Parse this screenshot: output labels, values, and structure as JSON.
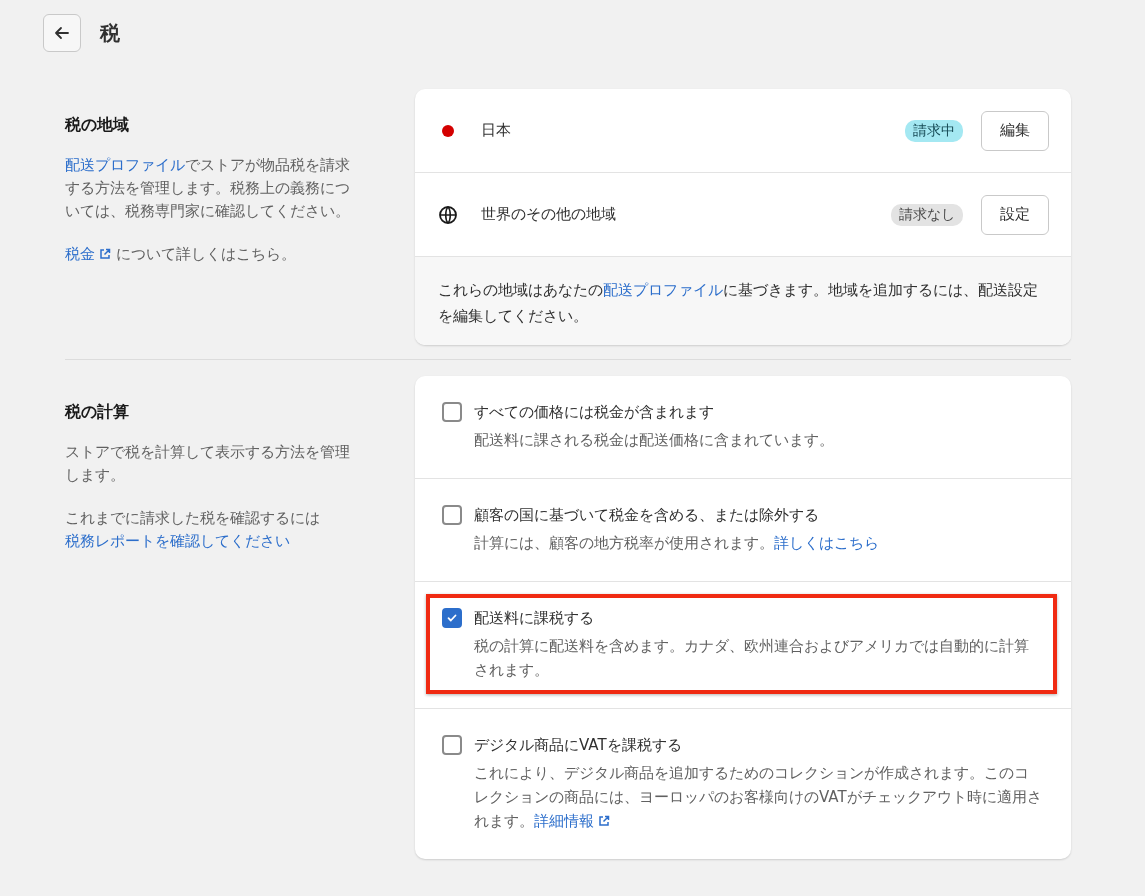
{
  "header": {
    "title": "税"
  },
  "sections": [
    {
      "title": "税の地域",
      "paragraphs": [
        [
          {
            "kind": "link",
            "text": "配送プロファイル"
          },
          {
            "kind": "text",
            "text": "でストアが物品税を請求する方法を管理します。税務上の義務については、税務専門家に確認してください。"
          }
        ],
        [
          {
            "kind": "external_link",
            "text": "税金"
          },
          {
            "kind": "text",
            "text": " について詳しくはこちら。"
          }
        ]
      ],
      "card": {
        "kind": "regions",
        "regions": [
          {
            "kind": "country",
            "color": "#d40000",
            "name": "日本",
            "status": "請求中",
            "charging": true,
            "button": "編集"
          },
          {
            "kind": "world",
            "name": "世界のその他の地域",
            "status": "請求なし",
            "charging": false,
            "button": "設定"
          }
        ],
        "footer": [
          {
            "kind": "text",
            "text": "これらの地域はあなたの"
          },
          {
            "kind": "link",
            "text": "配送プロファイル"
          },
          {
            "kind": "text",
            "text": "に基づきます。地域を追加するには、配送設定を編集してください。"
          }
        ]
      }
    },
    {
      "title": "税の計算",
      "paragraphs": [
        [
          {
            "kind": "text",
            "text": "ストアで税を計算して表示する方法を管理します。"
          }
        ],
        [
          {
            "kind": "text",
            "text": "これまでに請求した税を確認するには"
          },
          {
            "kind": "link",
            "text": "税務レポートを確認してください"
          }
        ]
      ],
      "card": {
        "kind": "options",
        "options": [
          {
            "label": "すべての価格には税金が含まれます",
            "checked": false,
            "highlighted": false,
            "help": [
              {
                "kind": "text",
                "text": "配送料に課される税金は配送価格に含まれています。"
              }
            ]
          },
          {
            "label": "顧客の国に基づいて税金を含める、または除外する",
            "checked": false,
            "highlighted": false,
            "help": [
              {
                "kind": "text",
                "text": "計算には、顧客の地方税率が使用されます。"
              },
              {
                "kind": "link",
                "text": "詳しくはこちら"
              }
            ]
          },
          {
            "label": "配送料に課税する",
            "checked": true,
            "highlighted": true,
            "help": [
              {
                "kind": "text",
                "text": "税の計算に配送料を含めます。カナダ、欧州連合およびアメリカでは自動的に計算されます。"
              }
            ]
          },
          {
            "label": "デジタル商品にVATを課税する",
            "checked": false,
            "highlighted": false,
            "help": [
              {
                "kind": "text",
                "text": "これにより、デジタル商品を追加するためのコレクションが作成されます。このコレクションの商品には、ヨーロッパのお客様向けのVATがチェックアウト時に適用されます。"
              },
              {
                "kind": "external_link",
                "text": "詳細情報"
              }
            ]
          }
        ]
      }
    }
  ]
}
